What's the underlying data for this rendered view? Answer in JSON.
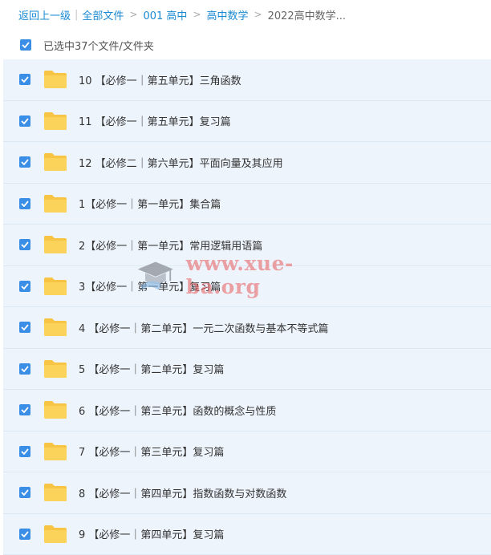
{
  "breadcrumb": {
    "back": "返回上一级",
    "items": [
      "全部文件",
      "001 高中",
      "高中数学"
    ],
    "current": "2022高中数学...",
    "separator": ">"
  },
  "selection": {
    "label": "已选中37个文件/文件夹",
    "checked": true
  },
  "files": [
    {
      "name": "10 【必修一｜第五单元】三角函数",
      "checked": true
    },
    {
      "name": "11 【必修一｜第五单元】复习篇",
      "checked": true
    },
    {
      "name": "12 【必修二｜第六单元】平面向量及其应用",
      "checked": true
    },
    {
      "name": "1【必修一｜第一单元】集合篇",
      "checked": true
    },
    {
      "name": "2【必修一｜第一单元】常用逻辑用语篇",
      "checked": true
    },
    {
      "name": "3【必修一｜第一单元】复习篇",
      "checked": true
    },
    {
      "name": "4 【必修一｜第二单元】一元二次函数与基本不等式篇",
      "checked": true
    },
    {
      "name": "5 【必修一｜第二单元】复习篇",
      "checked": true
    },
    {
      "name": "6 【必修一｜第三单元】函数的概念与性质",
      "checked": true
    },
    {
      "name": "7 【必修一｜第三单元】复习篇",
      "checked": true
    },
    {
      "name": "8 【必修一｜第四单元】指数函数与对数函数",
      "checked": true
    },
    {
      "name": "9 【必修一｜第四单元】复习篇",
      "checked": true
    }
  ],
  "watermark": {
    "text": "www.xue-ba.org"
  },
  "colors": {
    "accent": "#3a8ee6",
    "link": "#1a8ad3",
    "folder": "#fcd35a",
    "row_bg": "#eef4fc"
  },
  "icons": {
    "checkbox": "checkmark-icon",
    "folder": "folder-icon",
    "watermark_logo": "graduation-cap-icon"
  }
}
